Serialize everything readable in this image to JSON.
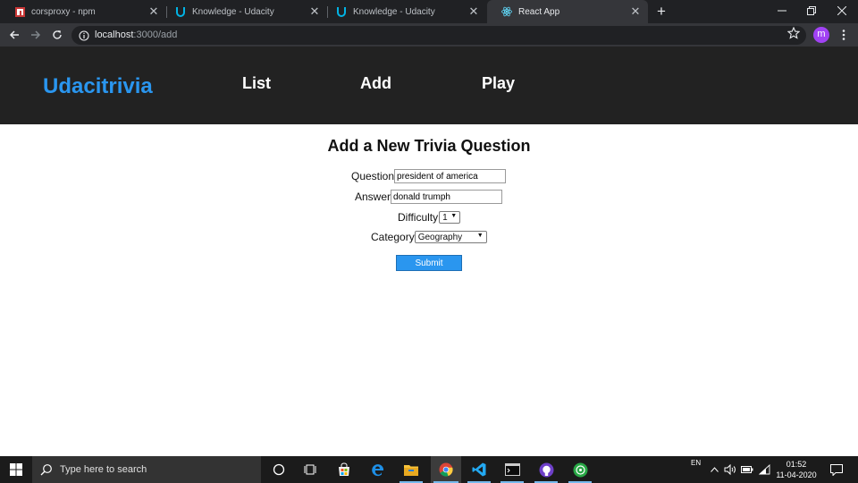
{
  "browser": {
    "tabs": [
      {
        "title": "corsproxy - npm",
        "icon": "npm-icon",
        "active": false
      },
      {
        "title": "Knowledge - Udacity",
        "icon": "udacity-icon",
        "active": false
      },
      {
        "title": "Knowledge - Udacity",
        "icon": "udacity-icon",
        "active": false
      },
      {
        "title": "React App",
        "icon": "react-icon",
        "active": true
      }
    ],
    "url_host": "localhost",
    "url_path": ":3000/add",
    "profile_initial": "m"
  },
  "header": {
    "brand": "Udacitrivia",
    "nav": {
      "list": "List",
      "add": "Add",
      "play": "Play"
    }
  },
  "form": {
    "title": "Add a New Trivia Question",
    "question_label": "Question",
    "question_value": "president of america",
    "answer_label": "Answer",
    "answer_value": "donald trumph",
    "difficulty_label": "Difficulty",
    "difficulty_value": "1",
    "category_label": "Category",
    "category_value": "Geography",
    "submit_label": "Submit"
  },
  "taskbar": {
    "search_placeholder": "Type here to search",
    "lang": "EN",
    "time": "01:52",
    "date": "11-04-2020"
  },
  "colors": {
    "brand": "#2a96ef",
    "header_bg": "#222222",
    "submit_bg": "#2a96ef"
  }
}
